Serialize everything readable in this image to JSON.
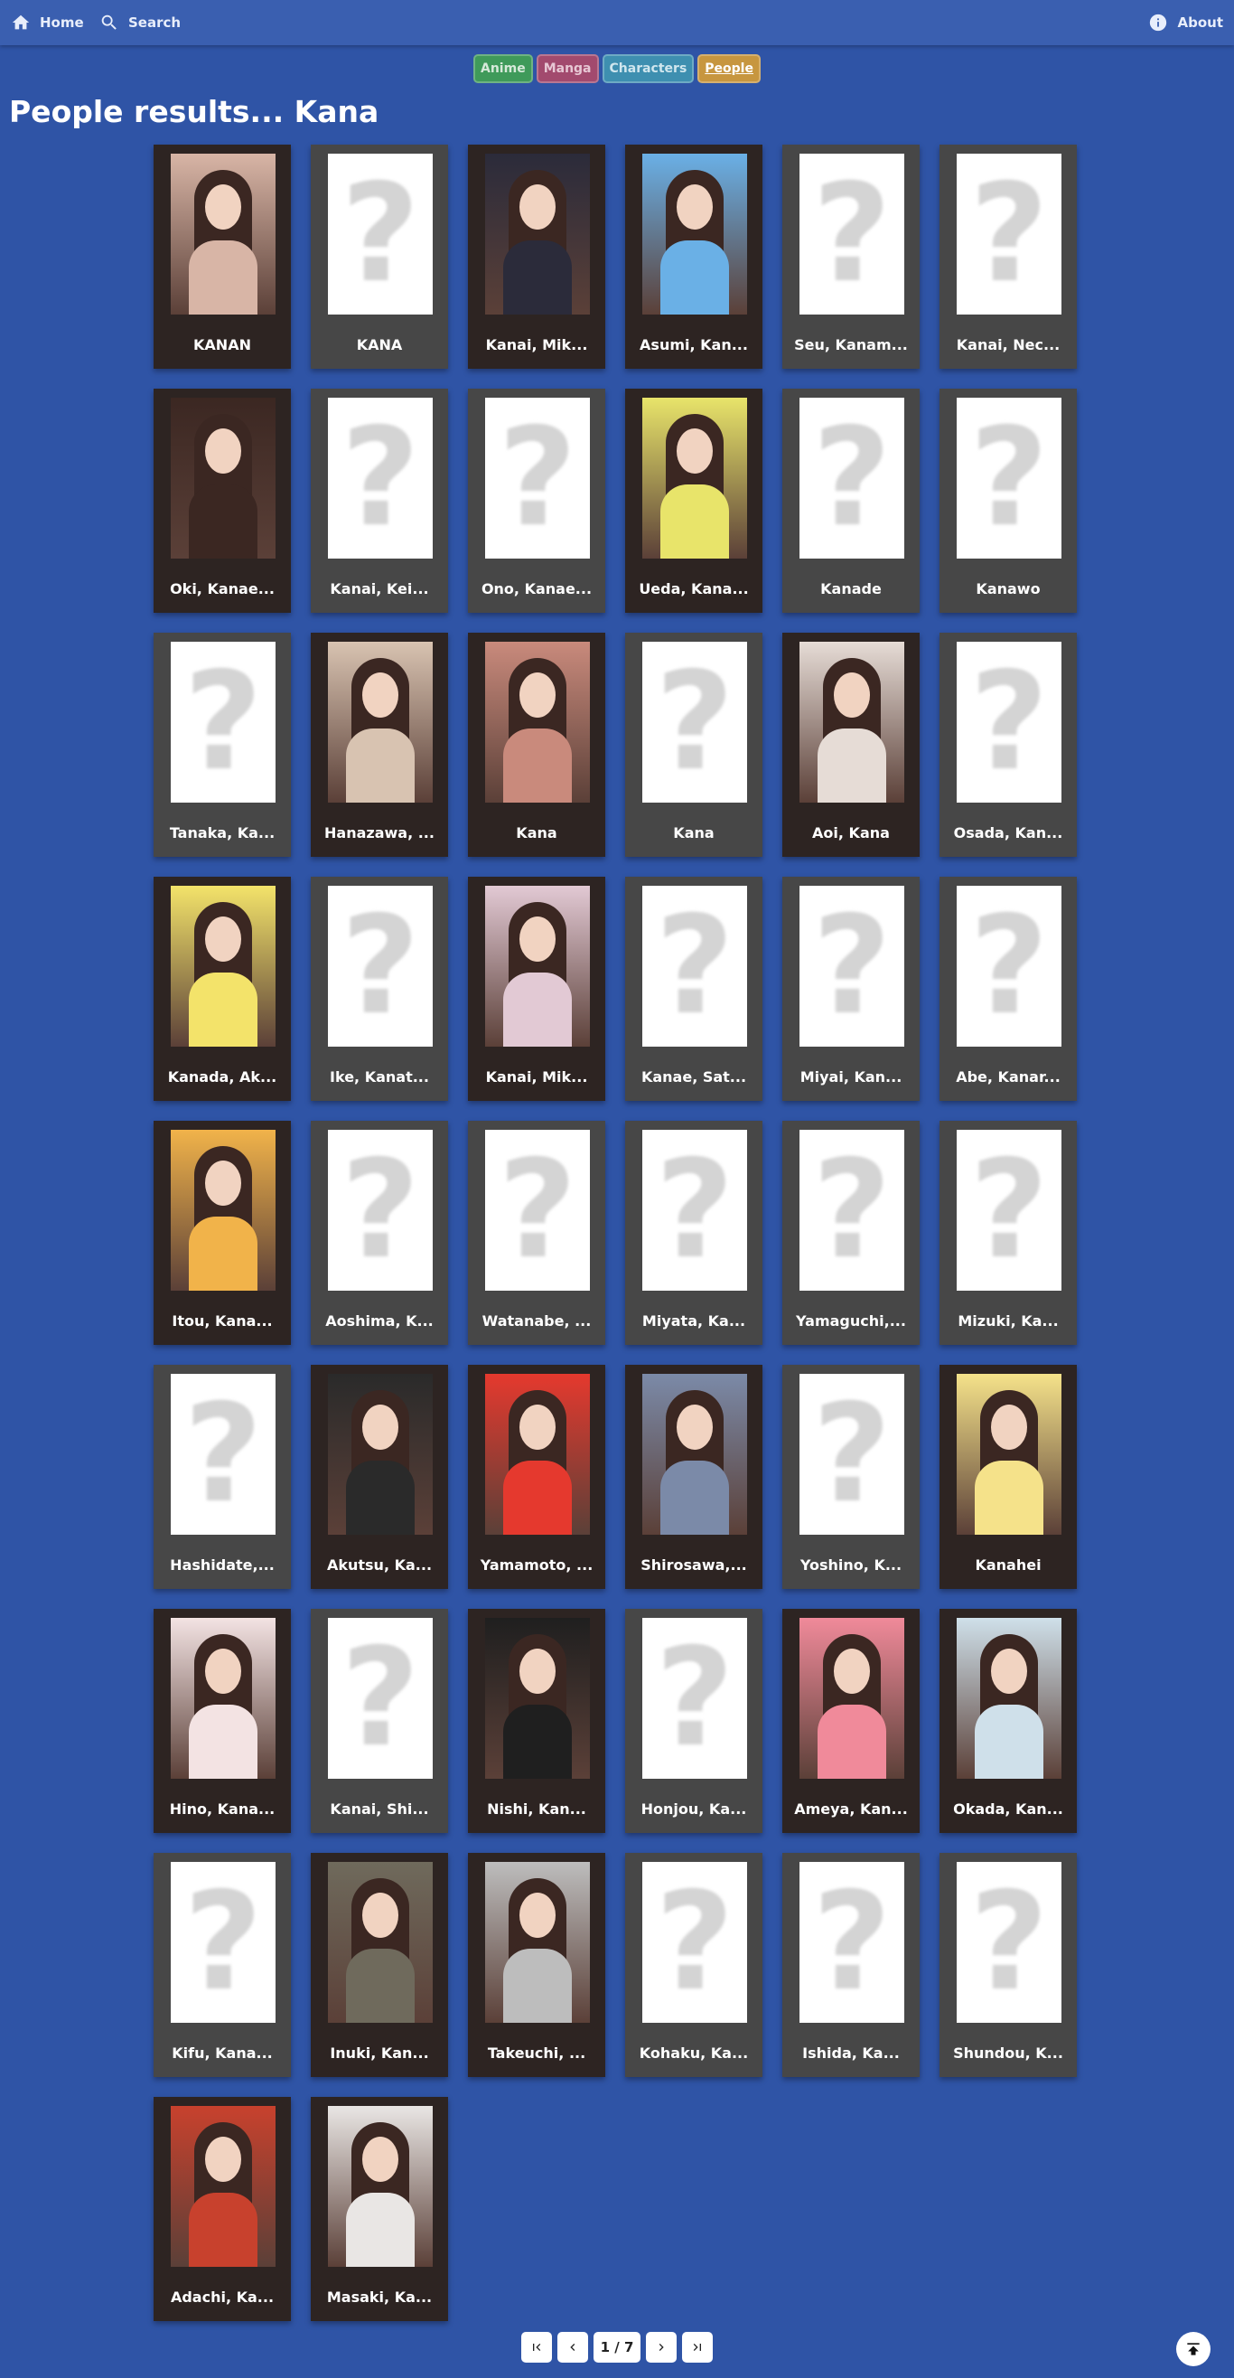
{
  "nav": {
    "home_label": "Home",
    "search_label": "Search",
    "about_label": "About"
  },
  "tabs": [
    {
      "label": "Anime",
      "color": "#3f9a5a"
    },
    {
      "label": "Manga",
      "color": "#a24a6e"
    },
    {
      "label": "Characters",
      "color": "#3e8fb0"
    },
    {
      "label": "People",
      "color": "#c7963f",
      "active": true
    }
  ],
  "page_title": "People results... Kana",
  "results": [
    {
      "name": "KANAN",
      "image": "photo",
      "tone": "#d8b5a6"
    },
    {
      "name": "KANA",
      "image": "placeholder"
    },
    {
      "name": "Kanai, Mik...",
      "image": "photo",
      "tone": "#2b2b3a"
    },
    {
      "name": "Asumi, Kan...",
      "image": "photo",
      "tone": "#6ab0e6"
    },
    {
      "name": "Seu, Kanam...",
      "image": "placeholder"
    },
    {
      "name": "Kanai, Nec...",
      "image": "placeholder"
    },
    {
      "name": "Oki, Kanae...",
      "image": "photo",
      "tone": "#3b2722"
    },
    {
      "name": "Kanai, Kei...",
      "image": "placeholder"
    },
    {
      "name": "Ono, Kanae...",
      "image": "placeholder"
    },
    {
      "name": "Ueda, Kana...",
      "image": "photo",
      "tone": "#e8e46a"
    },
    {
      "name": "Kanade",
      "image": "placeholder"
    },
    {
      "name": "Kanawo",
      "image": "placeholder"
    },
    {
      "name": "Tanaka, Ka...",
      "image": "placeholder"
    },
    {
      "name": "Hanazawa, ...",
      "image": "photo",
      "tone": "#d8c3b1"
    },
    {
      "name": "Kana",
      "image": "photo",
      "tone": "#c98a7c"
    },
    {
      "name": "Kana",
      "image": "placeholder"
    },
    {
      "name": "Aoi, Kana",
      "image": "photo",
      "tone": "#e6dcd6"
    },
    {
      "name": "Osada, Kan...",
      "image": "placeholder"
    },
    {
      "name": "Kanada, Ak...",
      "image": "photo",
      "tone": "#f3e36a"
    },
    {
      "name": "Ike, Kanat...",
      "image": "placeholder"
    },
    {
      "name": "Kanai, Mik...",
      "image": "photo",
      "tone": "#e2c9d4"
    },
    {
      "name": "Kanae, Sat...",
      "image": "placeholder"
    },
    {
      "name": "Miyai, Kan...",
      "image": "placeholder"
    },
    {
      "name": "Abe, Kanar...",
      "image": "placeholder"
    },
    {
      "name": "Itou, Kana...",
      "image": "photo",
      "tone": "#f1b34a"
    },
    {
      "name": "Aoshima, K...",
      "image": "placeholder"
    },
    {
      "name": "Watanabe, ...",
      "image": "placeholder"
    },
    {
      "name": "Miyata, Ka...",
      "image": "placeholder"
    },
    {
      "name": "Yamaguchi,...",
      "image": "placeholder"
    },
    {
      "name": "Mizuki, Ka...",
      "image": "placeholder"
    },
    {
      "name": "Hashidate,...",
      "image": "placeholder"
    },
    {
      "name": "Akutsu, Ka...",
      "image": "photo",
      "tone": "#2a2a2a"
    },
    {
      "name": "Yamamoto, ...",
      "image": "photo",
      "tone": "#e5392e"
    },
    {
      "name": "Shirosawa,...",
      "image": "photo",
      "tone": "#7b8aa8"
    },
    {
      "name": "Yoshino, K...",
      "image": "placeholder"
    },
    {
      "name": "Kanahei",
      "image": "photo",
      "tone": "#f5e28a"
    },
    {
      "name": "Hino, Kana...",
      "image": "photo",
      "tone": "#f3e3e3"
    },
    {
      "name": "Kanai, Shi...",
      "image": "placeholder"
    },
    {
      "name": "Nishi, Kan...",
      "image": "photo",
      "tone": "#1f1f1f"
    },
    {
      "name": "Honjou, Ka...",
      "image": "placeholder"
    },
    {
      "name": "Ameya, Kan...",
      "image": "photo",
      "tone": "#f08a9a"
    },
    {
      "name": "Okada, Kan...",
      "image": "photo",
      "tone": "#cfe0ea"
    },
    {
      "name": "Kifu, Kana...",
      "image": "placeholder"
    },
    {
      "name": "Inuki, Kan...",
      "image": "photo",
      "tone": "#6f6a5c"
    },
    {
      "name": "Takeuchi, ...",
      "image": "photo",
      "tone": "#bdbdbd"
    },
    {
      "name": "Kohaku, Ka...",
      "image": "placeholder"
    },
    {
      "name": "Ishida, Ka...",
      "image": "placeholder"
    },
    {
      "name": "Shundou, K...",
      "image": "placeholder"
    },
    {
      "name": "Adachi, Ka...",
      "image": "photo",
      "tone": "#c8412d"
    },
    {
      "name": "Masaki, Ka...",
      "image": "photo",
      "tone": "#e9e6e4"
    }
  ],
  "pagination": {
    "first_icon": "first-page-icon",
    "prev_icon": "prev-page-icon",
    "current": "1 / 7",
    "next_icon": "next-page-icon",
    "last_icon": "last-page-icon"
  },
  "scroll_top_icon": "scroll-to-top-icon"
}
